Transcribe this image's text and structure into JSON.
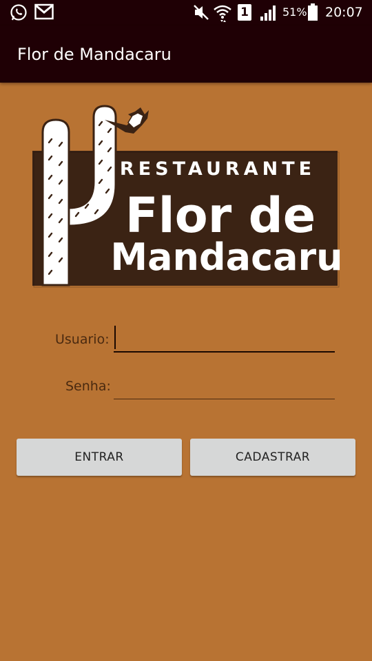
{
  "status_bar": {
    "icons": [
      "whatsapp-icon",
      "gmail-icon",
      "mute-icon",
      "wifi-icon",
      "sim1-icon",
      "signal-icon",
      "battery-icon"
    ],
    "sim_label": "1",
    "battery": "51%",
    "time": "20:07"
  },
  "app_bar": {
    "title": "Flor de Mandacaru"
  },
  "logo": {
    "line1": "RESTAURANTE",
    "line2": "Flor de",
    "line3": "Mandacaru",
    "colors": {
      "panel": "#3b2314",
      "text": "#ffffff",
      "background": "#b87333"
    }
  },
  "form": {
    "username_label": "Usuario:",
    "username_value": "",
    "password_label": "Senha:",
    "password_value": ""
  },
  "buttons": {
    "entrar": "ENTRAR",
    "cadastrar": "CADASTRAR"
  },
  "colors": {
    "accent": "#1f0005",
    "background": "#b87333",
    "button": "#d6d7d7"
  }
}
